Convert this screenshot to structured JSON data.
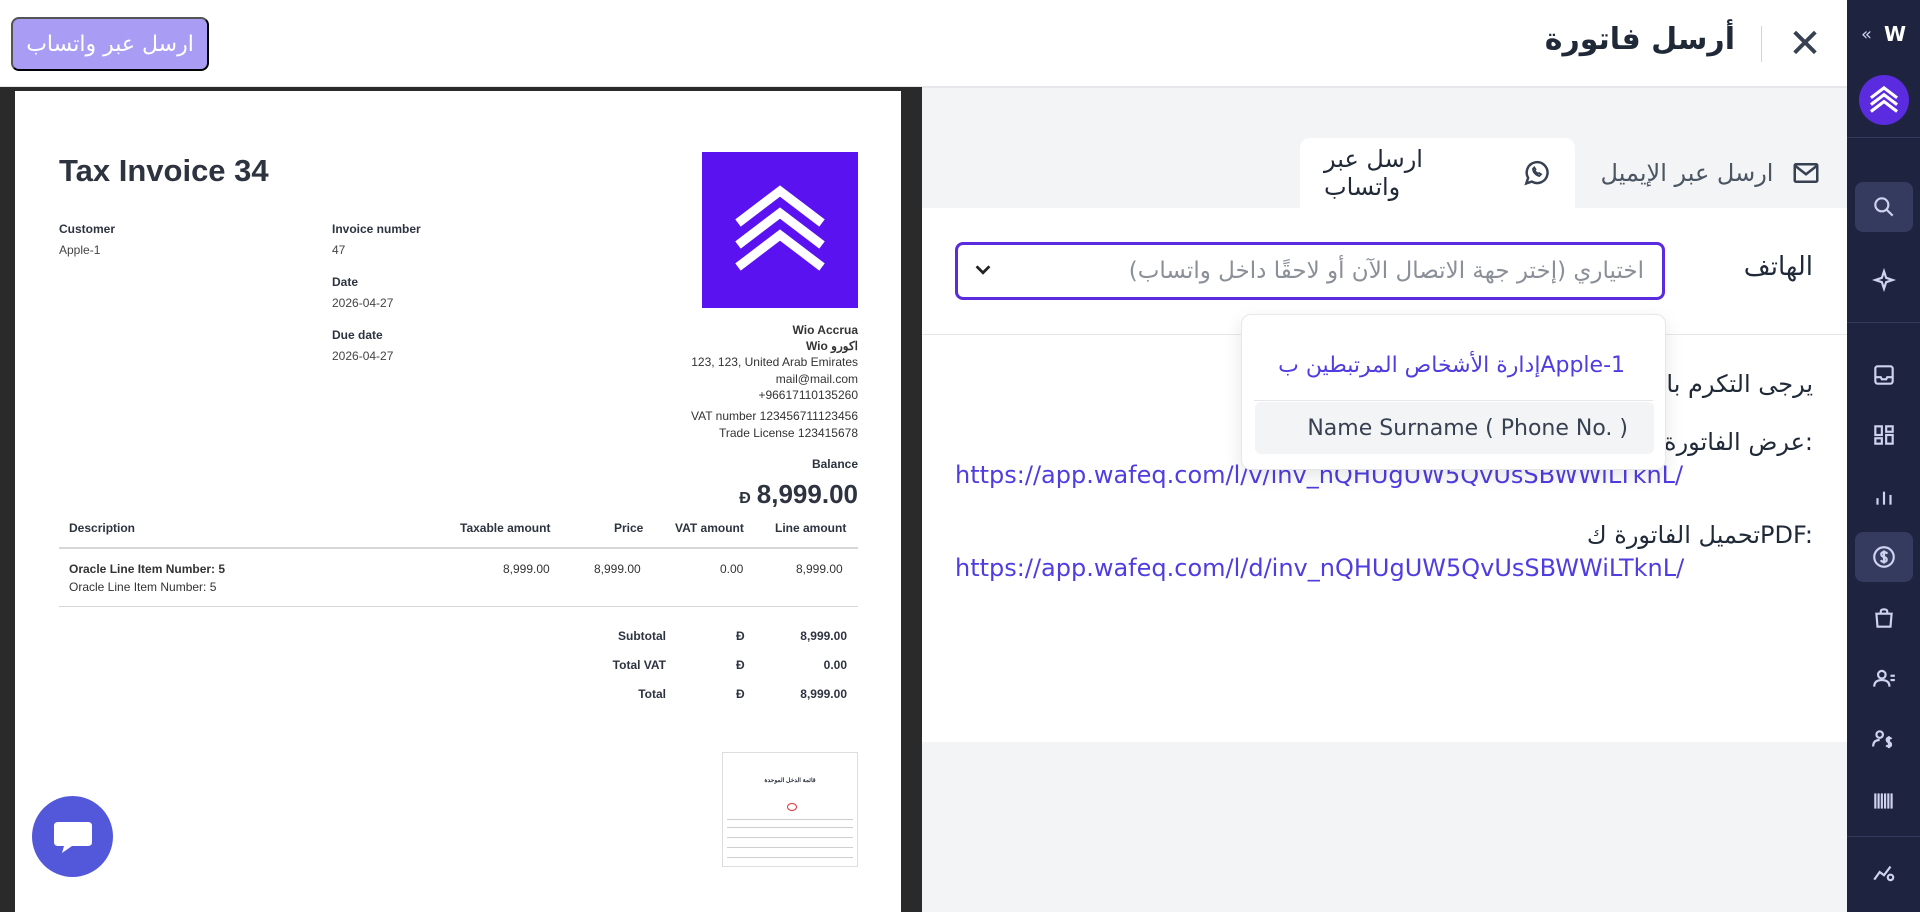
{
  "header": {
    "title": "أرسل فاتورة",
    "whatsapp_button": "ارسل عبر واتساب"
  },
  "tabs": [
    {
      "label": "ارسل عبر الإيميل",
      "icon": "mail-icon",
      "active": false
    },
    {
      "label": "ارسل عبر واتساب",
      "icon": "whatsapp-icon",
      "active": true
    }
  ],
  "form": {
    "phone_label": "الهاتف",
    "phone_placeholder": "اختياري (إختر جهة الاتصال الآن أو لاحقًا داخل واتساب)",
    "message_greeting": "يرجى التكرم بال",
    "view_label": "عرض الفاتورة:",
    "view_link": "https://app.wafeq.com/l/v/inv_nQHUgUW5QvUsSBWWiLTknL/",
    "download_label": "تحميل الفاتورة كPDF:",
    "download_link": "https://app.wafeq.com/l/d/inv_nQHUgUW5QvUsSBWWiLTknL/"
  },
  "dropdown": {
    "manage_link": "إدارة الأشخاص المرتبطين بApple-1",
    "option": "Name Surname ( Phone No. )"
  },
  "invoice": {
    "title": "Tax Invoice 34",
    "customer_label": "Customer",
    "customer": "Apple-1",
    "invoice_number_label": "Invoice number",
    "invoice_number": "47",
    "date_label": "Date",
    "date": "2026-04-27",
    "due_date_label": "Due date",
    "due_date": "2026-04-27",
    "company": "Wio Accrua",
    "company_ar": "Wio اكورو",
    "address": "123, 123, United Arab Emirates",
    "email": "mail@mail.com",
    "phone": "+96617110135260",
    "vat": "VAT number 123456711123456",
    "trade_license": "Trade License 123415678",
    "balance_label": "Balance",
    "currency": "Đ",
    "balance": "8,999.00",
    "columns": [
      "Description",
      "Taxable amount",
      "Price",
      "VAT amount",
      "Line amount"
    ],
    "item_title": "Oracle Line Item Number: 5",
    "item_desc": "Oracle Line Item Number: 5",
    "item_taxable": "8,999.00",
    "item_price": "8,999.00",
    "item_vat": "0.00",
    "item_line": "8,999.00",
    "subtotal_label": "Subtotal",
    "subtotal": "8,999.00",
    "total_vat_label": "Total VAT",
    "total_vat": "0.00",
    "total_label": "Total",
    "total": "8,999.00",
    "thumb_title": "قائمة الدخل الموحدة"
  },
  "sidebar": {
    "icons": [
      "search-icon",
      "sparkle-icon",
      "inbox-icon",
      "dashboard-icon",
      "bar-chart-icon",
      "dollar-icon",
      "shopping-bag-icon",
      "contacts-icon",
      "payroll-icon",
      "barcode-icon",
      "analytics-settings-icon"
    ]
  },
  "colors": {
    "accent": "#5b2be0",
    "link": "#4f3de0",
    "sidebar_bg": "#1e2340",
    "whatsapp_button_bg": "#a99cf4"
  }
}
